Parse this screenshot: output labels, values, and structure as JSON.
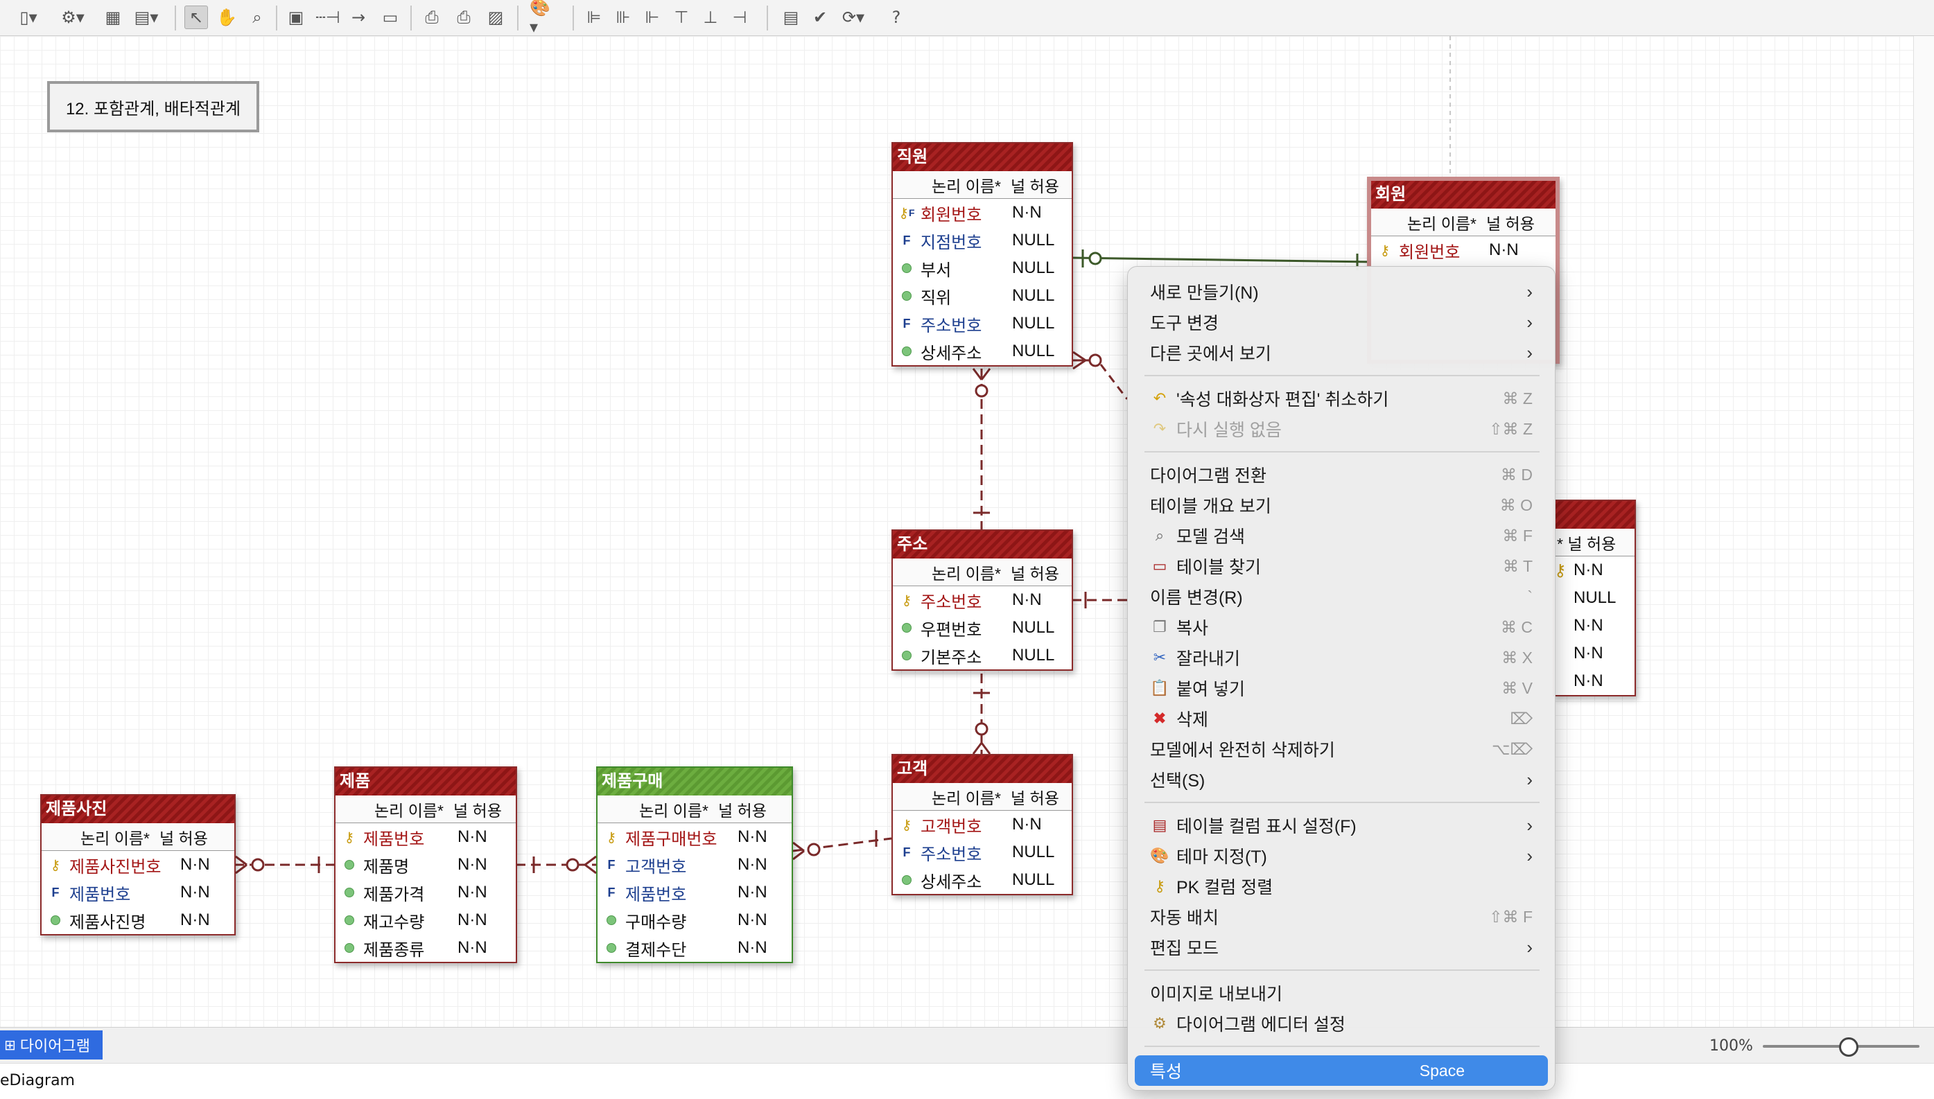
{
  "toolbar": {
    "icons": [
      "note-icon",
      "entity-tool-icon",
      "table-icon",
      "view-icon",
      "select-arrow-icon",
      "hand-icon",
      "zoom-icon",
      "new-entity-icon",
      "relation-dashed-icon",
      "relation-solid-icon",
      "comment-icon",
      "print-preview-icon",
      "print-icon",
      "image-icon",
      "palette-icon",
      "align-left-icon",
      "align-center-icon",
      "align-right-icon",
      "align-top-icon",
      "align-middle-icon",
      "align-bottom-icon",
      "document-icon",
      "validate-icon",
      "refresh-icon",
      "help-icon"
    ]
  },
  "diagram_title": "12. 포함관계, 배타적관계",
  "column_headers": {
    "name": "논리 이름*",
    "null": "널 허용"
  },
  "entities": [
    {
      "title": "직원",
      "rows": [
        {
          "name": "회원번호",
          "null": "N·N",
          "kind": "pkfk"
        },
        {
          "name": "지점번호",
          "null": "NULL",
          "kind": "fk"
        },
        {
          "name": "부서",
          "null": "NULL",
          "kind": "attr"
        },
        {
          "name": "직위",
          "null": "NULL",
          "kind": "attr"
        },
        {
          "name": "주소번호",
          "null": "NULL",
          "kind": "fk"
        },
        {
          "name": "상세주소",
          "null": "NULL",
          "kind": "attr"
        }
      ]
    },
    {
      "title": "회원",
      "rows": [
        {
          "name": "회원번호",
          "null": "N·N",
          "kind": "pk"
        }
      ]
    },
    {
      "title": "주소",
      "rows": [
        {
          "name": "주소번호",
          "null": "N·N",
          "kind": "pk"
        },
        {
          "name": "우편번호",
          "null": "NULL",
          "kind": "attr"
        },
        {
          "name": "기본주소",
          "null": "NULL",
          "kind": "attr"
        }
      ]
    },
    {
      "title": "고객",
      "rows": [
        {
          "name": "고객번호",
          "null": "N·N",
          "kind": "pk"
        },
        {
          "name": "주소번호",
          "null": "NULL",
          "kind": "fk"
        },
        {
          "name": "상세주소",
          "null": "NULL",
          "kind": "attr"
        }
      ]
    },
    {
      "title": "제품사진",
      "rows": [
        {
          "name": "제품사진번호",
          "null": "N·N",
          "kind": "pk"
        },
        {
          "name": "제품번호",
          "null": "N·N",
          "kind": "fk"
        },
        {
          "name": "제품사진명",
          "null": "N·N",
          "kind": "attr"
        }
      ]
    },
    {
      "title": "제품",
      "rows": [
        {
          "name": "제품번호",
          "null": "N·N",
          "kind": "pk"
        },
        {
          "name": "제품명",
          "null": "N·N",
          "kind": "attr"
        },
        {
          "name": "제품가격",
          "null": "N·N",
          "kind": "attr"
        },
        {
          "name": "재고수량",
          "null": "N·N",
          "kind": "attr"
        },
        {
          "name": "제품종류",
          "null": "N·N",
          "kind": "attr"
        }
      ]
    },
    {
      "title": "제품구매",
      "rows": [
        {
          "name": "제품구매번호",
          "null": "N·N",
          "kind": "pk"
        },
        {
          "name": "고객번호",
          "null": "N·N",
          "kind": "fk"
        },
        {
          "name": "제품번호",
          "null": "N·N",
          "kind": "fk"
        },
        {
          "name": "구매수량",
          "null": "N·N",
          "kind": "attr"
        },
        {
          "name": "결제수단",
          "null": "N·N",
          "kind": "attr"
        }
      ]
    },
    {
      "title": "",
      "col_null_only": "* 널 허용",
      "rows": [
        {
          "name": "",
          "null": "N·N",
          "kind": "pk"
        },
        {
          "name": "",
          "null": "NULL",
          "kind": "none"
        },
        {
          "name": "",
          "null": "N·N",
          "kind": "none"
        },
        {
          "name": "",
          "null": "N·N",
          "kind": "none"
        },
        {
          "name": "",
          "null": "N·N",
          "kind": "none"
        }
      ]
    }
  ],
  "context_menu": {
    "items": [
      {
        "label": "새로 만들기(N)",
        "submenu": true
      },
      {
        "label": "도구 변경",
        "submenu": true
      },
      {
        "label": "다른 곳에서 보기",
        "submenu": true
      },
      {
        "label": "'속성 대화상자 편집' 취소하기",
        "shortcut": "⌘ Z",
        "icon": "undo-icon"
      },
      {
        "label": "다시 실행 없음",
        "shortcut": "⇧⌘ Z",
        "icon": "redo-icon",
        "disabled": true
      },
      {
        "label": "다이어그램 전환",
        "shortcut": "⌘ D"
      },
      {
        "label": "테이블 개요 보기",
        "shortcut": "⌘ O"
      },
      {
        "label": "모델 검색",
        "shortcut": "⌘ F",
        "icon": "search-icon"
      },
      {
        "label": "테이블 찾기",
        "shortcut": "⌘ T",
        "icon": "table-find-icon"
      },
      {
        "label": "이름 변경(R)",
        "shortcut": "`"
      },
      {
        "label": "복사",
        "shortcut": "⌘ C",
        "icon": "copy-icon"
      },
      {
        "label": "잘라내기",
        "shortcut": "⌘ X",
        "icon": "cut-icon"
      },
      {
        "label": "붙여 넣기",
        "shortcut": "⌘ V",
        "icon": "paste-icon"
      },
      {
        "label": "삭제",
        "shortcut": "⌦",
        "icon": "delete-icon"
      },
      {
        "label": "모델에서 완전히 삭제하기",
        "shortcut": "⌥⌦"
      },
      {
        "label": "선택(S)",
        "submenu": true
      },
      {
        "label": "테이블 컬럼 표시 설정(F)",
        "submenu": true,
        "icon": "column-display-icon"
      },
      {
        "label": "테마 지정(T)",
        "submenu": true,
        "icon": "theme-icon"
      },
      {
        "label": "PK 컬럼 정렬",
        "icon": "sort-icon"
      },
      {
        "label": "자동 배치",
        "shortcut": "⇧⌘ F"
      },
      {
        "label": "편집 모드",
        "submenu": true
      },
      {
        "label": "이미지로 내보내기"
      },
      {
        "label": "다이어그램 에디터 설정",
        "icon": "settings-icon"
      },
      {
        "label": "특성",
        "shortcut": "Space",
        "selected": true
      }
    ]
  },
  "tab": {
    "label": "다이어그램"
  },
  "zoom": {
    "label": "100%",
    "value": 0.55
  },
  "status": {
    "text": "eDiagram"
  }
}
